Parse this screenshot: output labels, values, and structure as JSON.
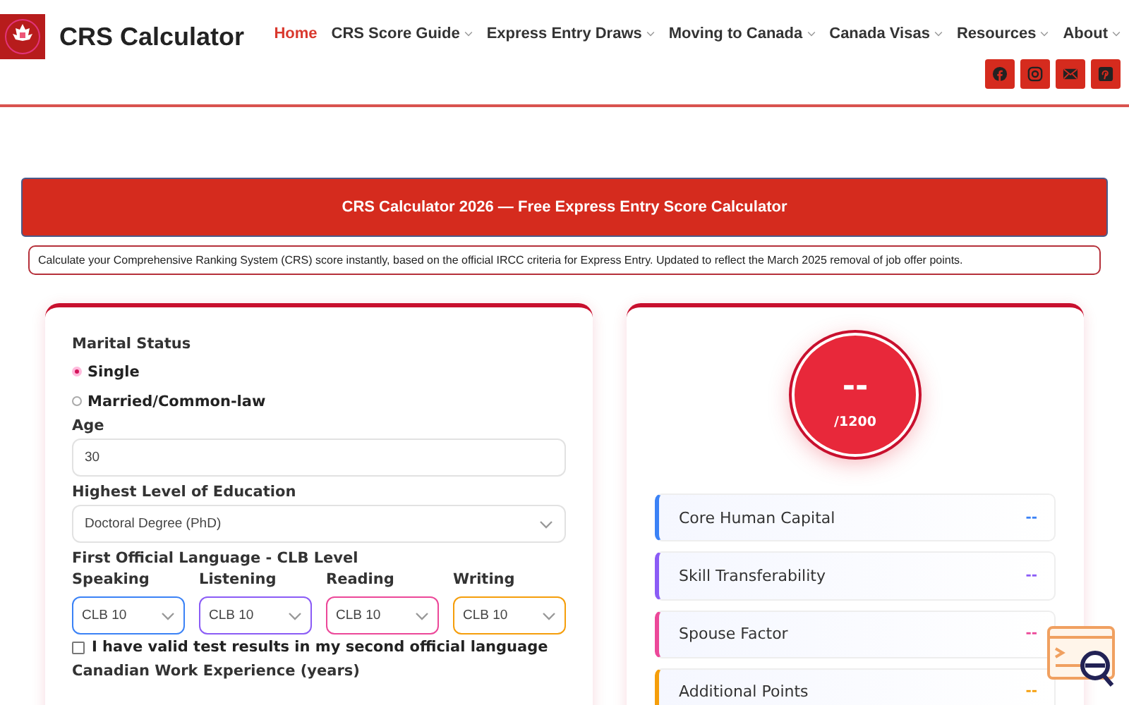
{
  "header": {
    "site_title": "CRS Calculator",
    "nav": [
      {
        "label": "Home",
        "selected": true,
        "dropdown": false
      },
      {
        "label": "CRS Score Guide",
        "selected": false,
        "dropdown": true
      },
      {
        "label": "Express Entry Draws",
        "selected": false,
        "dropdown": true
      },
      {
        "label": "Moving to Canada",
        "selected": false,
        "dropdown": true
      },
      {
        "label": "Canada Visas",
        "selected": false,
        "dropdown": true
      },
      {
        "label": "Resources",
        "selected": false,
        "dropdown": true
      },
      {
        "label": "About",
        "selected": false,
        "dropdown": true
      }
    ],
    "social": [
      {
        "kind": "facebook"
      },
      {
        "kind": "instagram"
      },
      {
        "kind": "email"
      },
      {
        "kind": "pinterest"
      }
    ]
  },
  "banner": {
    "title": "CRS Calculator 2026 — Free Express Entry Score Calculator",
    "description": "Calculate your Comprehensive Ranking System (CRS) score instantly, based on the official IRCC criteria for Express Entry. Updated to reflect the March 2025 removal of job offer points."
  },
  "form": {
    "marital_status": {
      "label": "Marital Status",
      "options": [
        {
          "label": "Single",
          "selected": true
        },
        {
          "label": "Married/Common-law",
          "selected": false
        }
      ]
    },
    "age": {
      "label": "Age",
      "value": "30"
    },
    "education": {
      "label": "Highest Level of Education",
      "value": "Doctoral Degree (PhD)"
    },
    "language": {
      "label": "First Official Language - CLB Level",
      "skills": [
        {
          "label": "Speaking",
          "value": "CLB 10",
          "color": "#3b82f6"
        },
        {
          "label": "Listening",
          "value": "CLB 10",
          "color": "#8b5cf6"
        },
        {
          "label": "Reading",
          "value": "CLB 10",
          "color": "#ec4899"
        },
        {
          "label": "Writing",
          "value": "CLB 10",
          "color": "#f59e0b"
        }
      ]
    },
    "second_language": {
      "label": "I have valid test results in my second official language",
      "checked": false
    },
    "work_experience": {
      "label": "Canadian Work Experience (years)"
    }
  },
  "results": {
    "score": "--",
    "max": "/1200",
    "breakdown": [
      {
        "label": "Core Human Capital",
        "value": "--",
        "color": "#3b82f6"
      },
      {
        "label": "Skill Transferability",
        "value": "--",
        "color": "#8b5cf6"
      },
      {
        "label": "Spouse Factor",
        "value": "--",
        "color": "#ec4899"
      },
      {
        "label": "Additional Points",
        "value": "--",
        "color": "#f59e0b"
      }
    ]
  }
}
